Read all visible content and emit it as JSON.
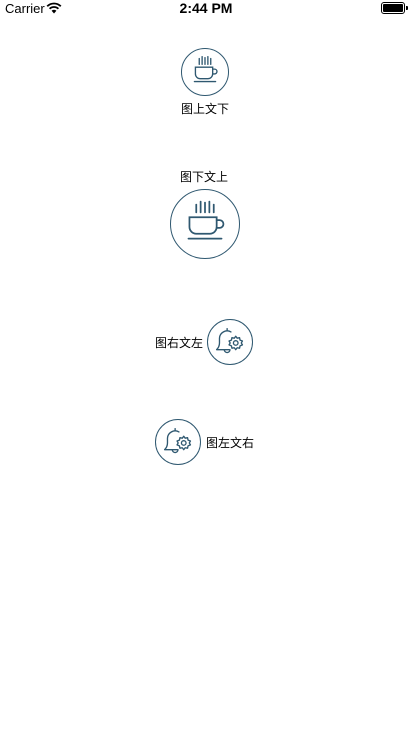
{
  "status_bar": {
    "carrier": "Carrier",
    "time": "2:44 PM"
  },
  "buttons": [
    {
      "label": "图上文下",
      "icon": "coffee-cup-icon"
    },
    {
      "label": "图下文上",
      "icon": "coffee-cup-icon"
    },
    {
      "label": "图右文左",
      "icon": "bell-gear-icon"
    },
    {
      "label": "图左文右",
      "icon": "bell-gear-icon"
    }
  ],
  "colors": {
    "icon_stroke": "#2f5870",
    "background": "#ffffff"
  }
}
